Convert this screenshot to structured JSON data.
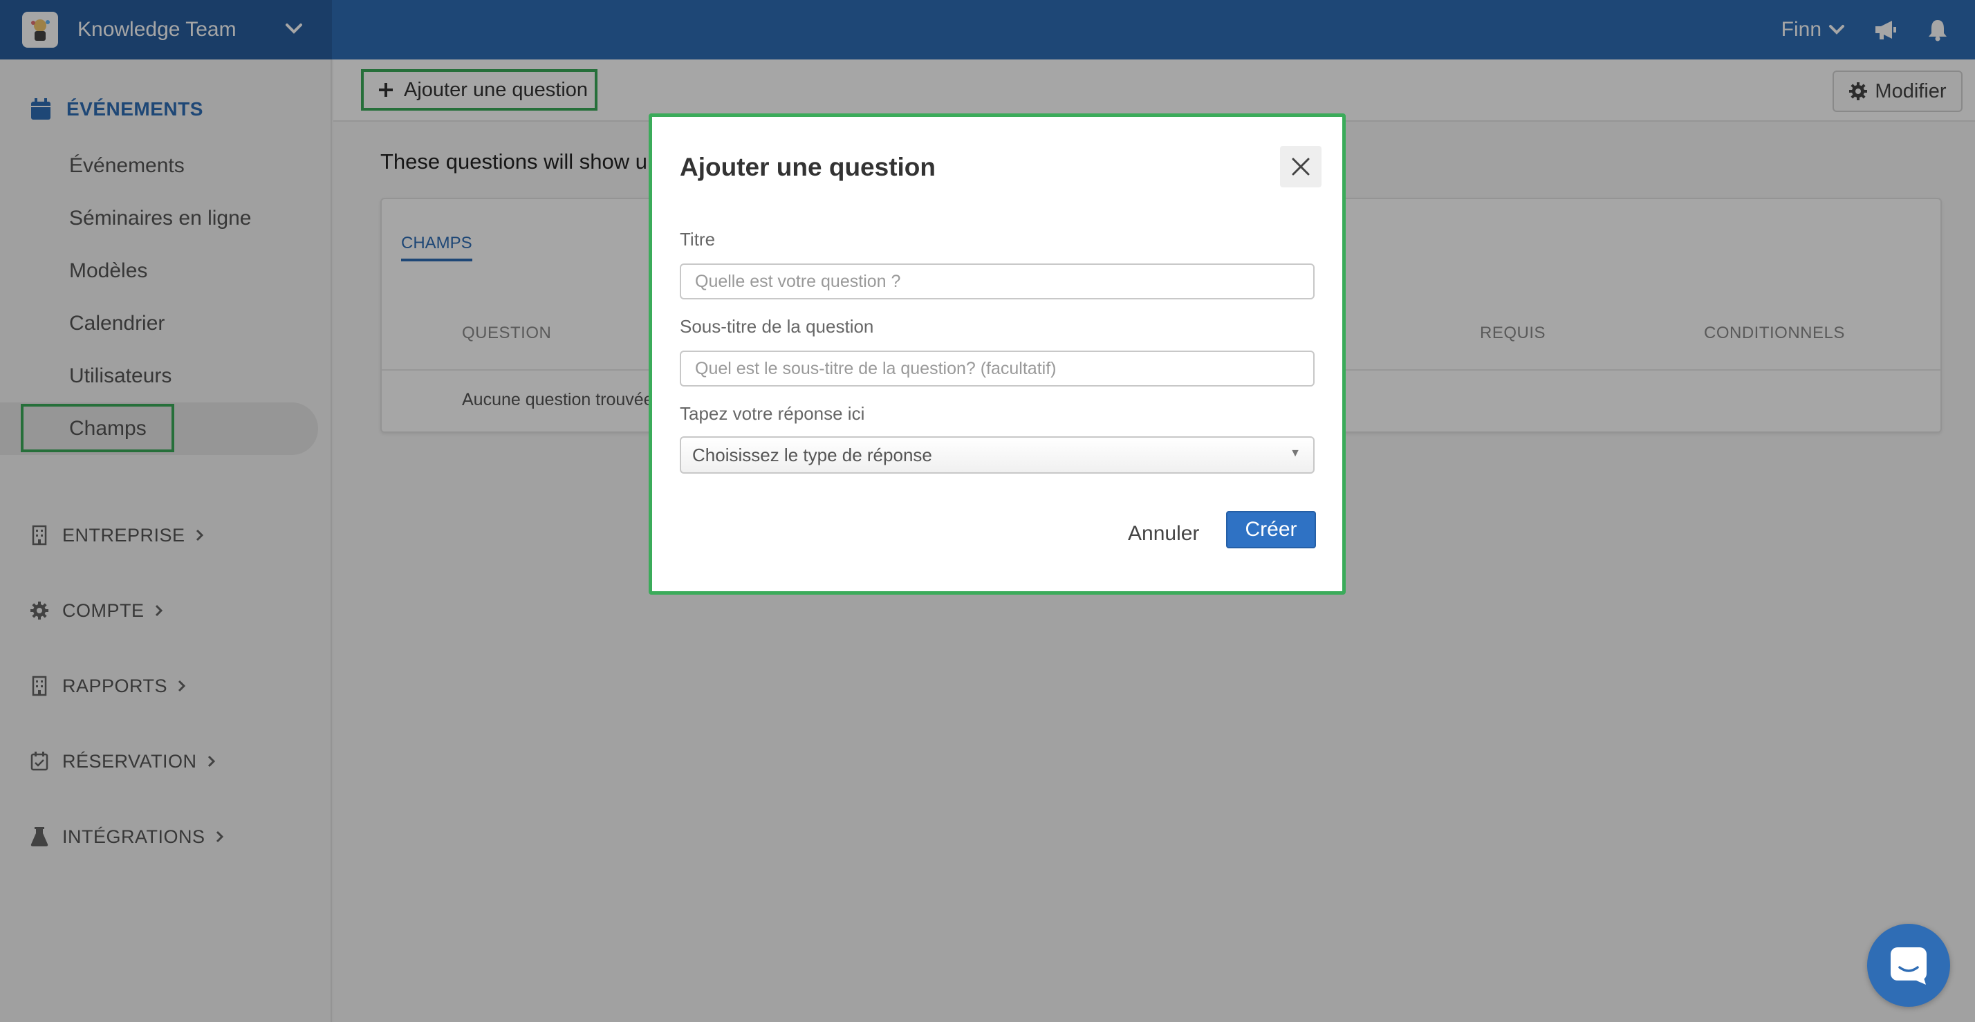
{
  "topbar": {
    "team_name": "Knowledge Team",
    "user_name": "Finn",
    "icons": [
      "team-logo-icon",
      "chevron-down-icon",
      "megaphone-icon",
      "bell-icon"
    ]
  },
  "sidebar": {
    "section": {
      "label": "ÉVÉNEMENTS",
      "icon": "calendar-icon"
    },
    "items": [
      {
        "label": "Événements"
      },
      {
        "label": "Séminaires en ligne"
      },
      {
        "label": "Modèles"
      },
      {
        "label": "Calendrier"
      },
      {
        "label": "Utilisateurs"
      },
      {
        "label": "Champs",
        "active": true
      }
    ],
    "groups": [
      {
        "label": "ENTREPRISE",
        "icon": "building-icon"
      },
      {
        "label": "COMPTE",
        "icon": "gear-icon"
      },
      {
        "label": "RAPPORTS",
        "icon": "building-icon"
      },
      {
        "label": "RÉSERVATION",
        "icon": "calendar-check-icon"
      },
      {
        "label": "INTÉGRATIONS",
        "icon": "flask-icon"
      }
    ]
  },
  "toolbar": {
    "add_label": "Ajouter une question",
    "modify_label": "Modifier"
  },
  "main": {
    "info_text": "These questions will show u",
    "tab_label": "CHAMPS",
    "columns": [
      "QUESTION",
      "REQUIS",
      "CONDITIONNELS"
    ],
    "empty_text": "Aucune question trouvée"
  },
  "modal": {
    "title": "Ajouter une question",
    "title_label": "Titre",
    "title_placeholder": "Quelle est votre question ?",
    "subtitle_label": "Sous-titre de la question",
    "subtitle_placeholder": "Quel est le sous-titre de la question? (facultatif)",
    "answer_label": "Tapez votre réponse ici",
    "answer_select": "Choisissez le type de réponse",
    "cancel_label": "Annuler",
    "create_label": "Créer"
  },
  "colors": {
    "brand": "#2f6db5",
    "highlight": "#3bab5a",
    "primary_button": "#2f72c4"
  }
}
